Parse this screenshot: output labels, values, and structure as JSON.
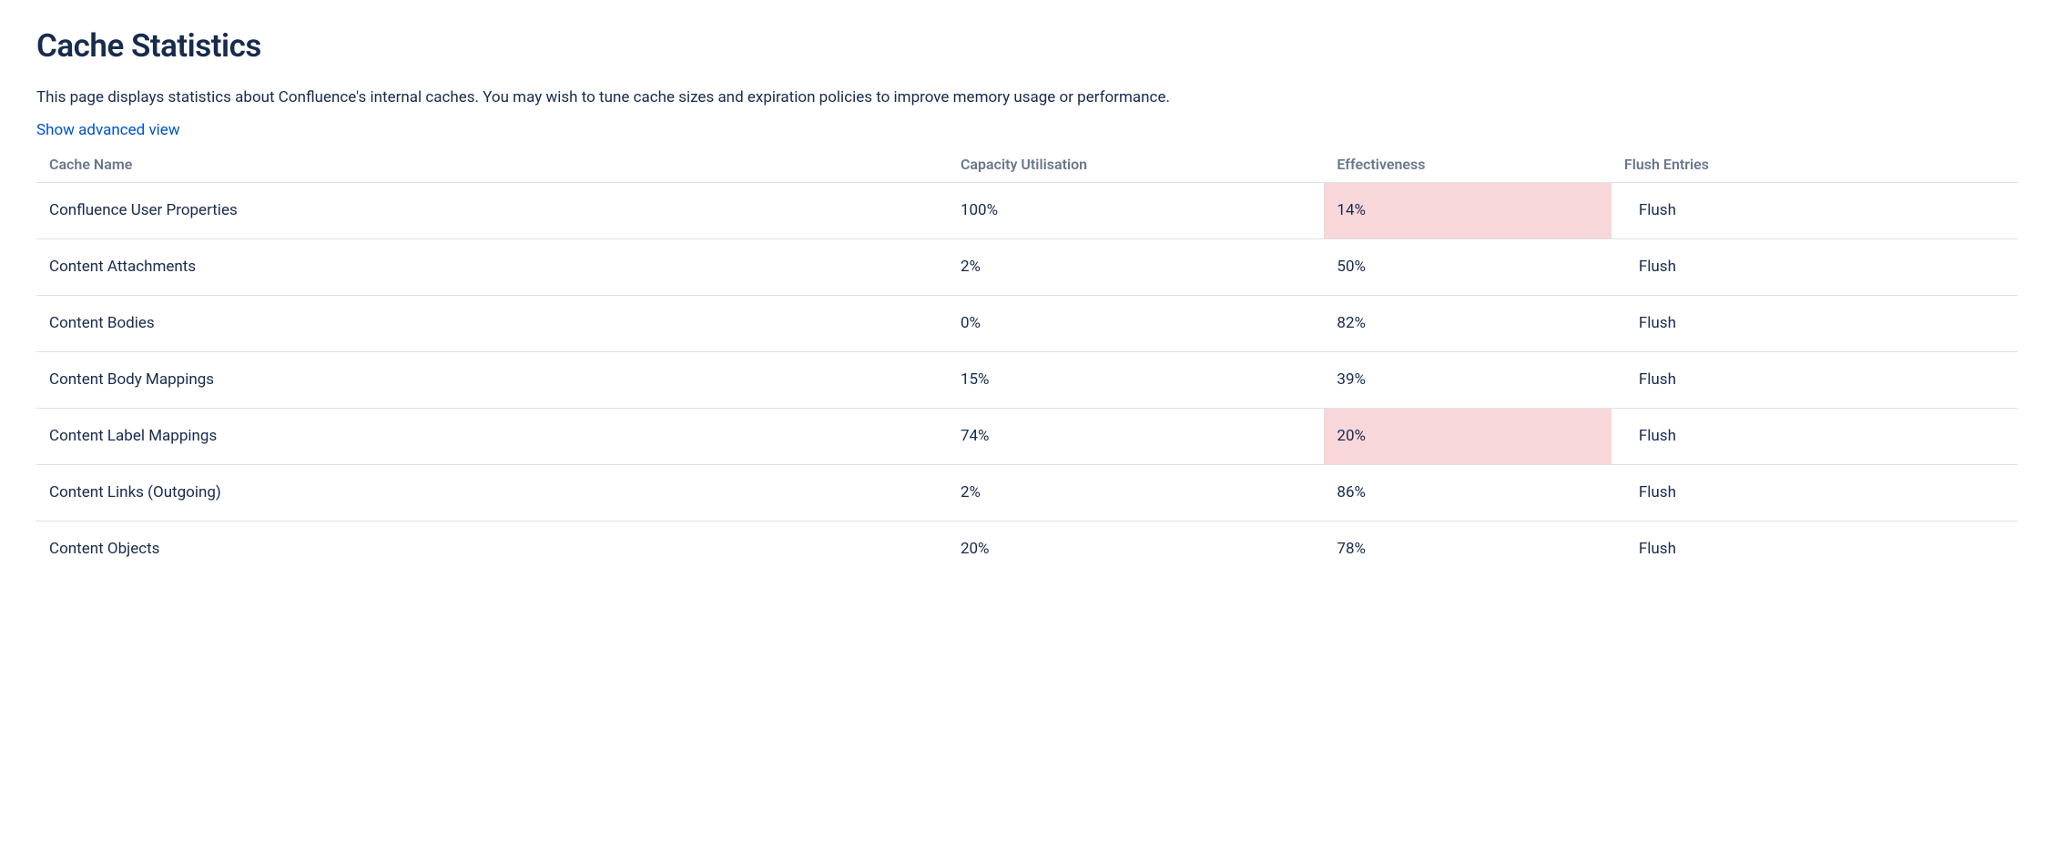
{
  "page": {
    "title": "Cache Statistics",
    "description": "This page displays statistics about Confluence's internal caches. You may wish to tune cache sizes and expiration policies to improve memory usage or performance.",
    "advanced_link": "Show advanced view"
  },
  "table": {
    "headers": {
      "name": "Cache Name",
      "capacity": "Capacity Utilisation",
      "effectiveness": "Effectiveness",
      "flush": "Flush Entries"
    },
    "flush_label": "Flush",
    "rows": [
      {
        "name": "Confluence User Properties",
        "capacity": "100%",
        "effectiveness": "14%",
        "highlight": true
      },
      {
        "name": "Content Attachments",
        "capacity": "2%",
        "effectiveness": "50%",
        "highlight": false
      },
      {
        "name": "Content Bodies",
        "capacity": "0%",
        "effectiveness": "82%",
        "highlight": false
      },
      {
        "name": "Content Body Mappings",
        "capacity": "15%",
        "effectiveness": "39%",
        "highlight": false
      },
      {
        "name": "Content Label Mappings",
        "capacity": "74%",
        "effectiveness": "20%",
        "highlight": true
      },
      {
        "name": "Content Links (Outgoing)",
        "capacity": "2%",
        "effectiveness": "86%",
        "highlight": false
      },
      {
        "name": "Content Objects",
        "capacity": "20%",
        "effectiveness": "78%",
        "highlight": false
      }
    ]
  }
}
